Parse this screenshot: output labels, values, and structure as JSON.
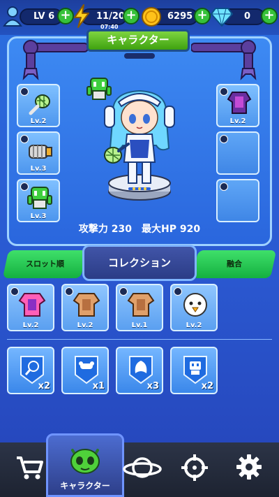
{
  "topbar": {
    "level": "LV 6",
    "energy": "11/20",
    "clock": "07:40",
    "coins": "6295",
    "gems": "0",
    "plus": "+"
  },
  "panel": {
    "title": "キャラクター",
    "left_slots": [
      "Lv.2",
      "Lv.3",
      "Lv.3"
    ],
    "right_slots": [
      "Lv.2",
      "",
      ""
    ],
    "stats": "攻撃力 230　最大HP 920"
  },
  "tabs": {
    "left": "スロット順",
    "center": "コレクション",
    "right": "融合"
  },
  "collection": {
    "row1": [
      {
        "level": "Lv.2",
        "icon": "pink-armor"
      },
      {
        "level": "Lv.2",
        "icon": "bronze-armor"
      },
      {
        "level": "Lv.1",
        "icon": "bronze-armor"
      },
      {
        "level": "Lv.2",
        "icon": "chick"
      }
    ],
    "row2": [
      {
        "count": "x2",
        "icon": "racket"
      },
      {
        "count": "x1",
        "icon": "bone-badge"
      },
      {
        "count": "x3",
        "icon": "shield"
      },
      {
        "count": "x2",
        "icon": "robot"
      }
    ]
  },
  "nav": {
    "active_label": "キャラクター"
  },
  "colors": {
    "accent_green": "#36c13a",
    "panel_blue": "#2a66dd",
    "nav_dark": "#1d2331"
  }
}
